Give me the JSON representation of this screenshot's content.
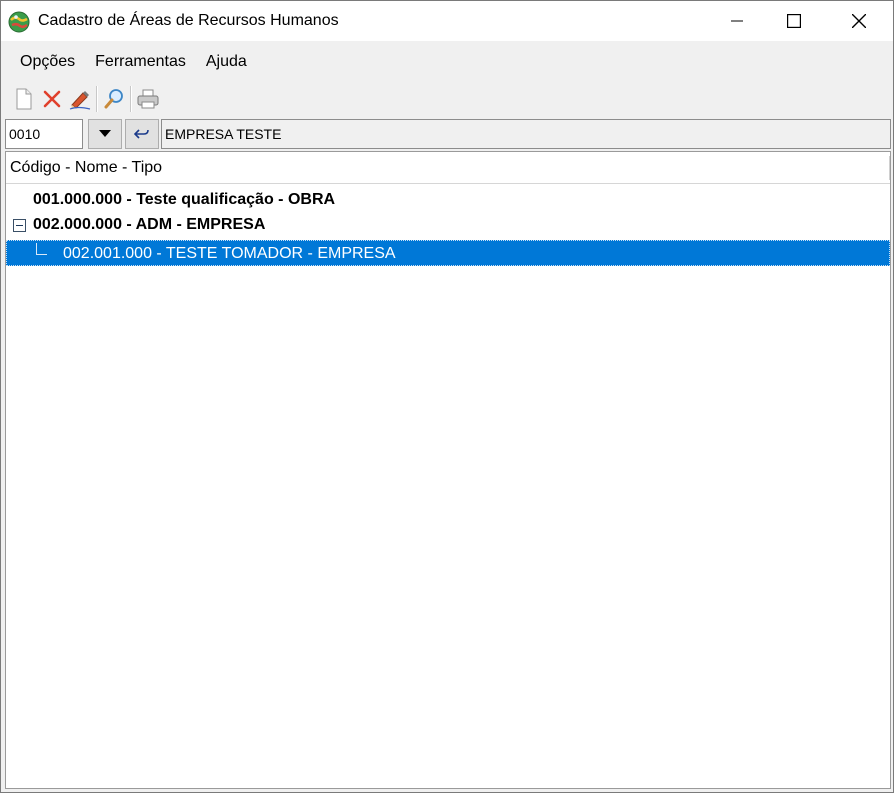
{
  "window": {
    "title": "Cadastro de Áreas de Recursos Humanos",
    "icon": "globe-icon"
  },
  "menu": {
    "items": [
      "Opções",
      "Ferramentas",
      "Ajuda"
    ]
  },
  "toolbar": {
    "buttons": [
      "new-document-icon",
      "delete-icon",
      "edit-icon",
      "search-icon",
      "print-icon"
    ]
  },
  "selector": {
    "code": "0010",
    "company": "EMPRESA TESTE"
  },
  "tree": {
    "header": "Código - Nome - Tipo",
    "rows": [
      {
        "label": "001.000.000 - Teste qualificação - OBRA"
      },
      {
        "label": "002.000.000 - ADM - EMPRESA"
      },
      {
        "label": "002.001.000 - TESTE TOMADOR - EMPRESA"
      }
    ]
  },
  "colors": {
    "selection": "#0078d7",
    "background": "#f0f0f0"
  }
}
